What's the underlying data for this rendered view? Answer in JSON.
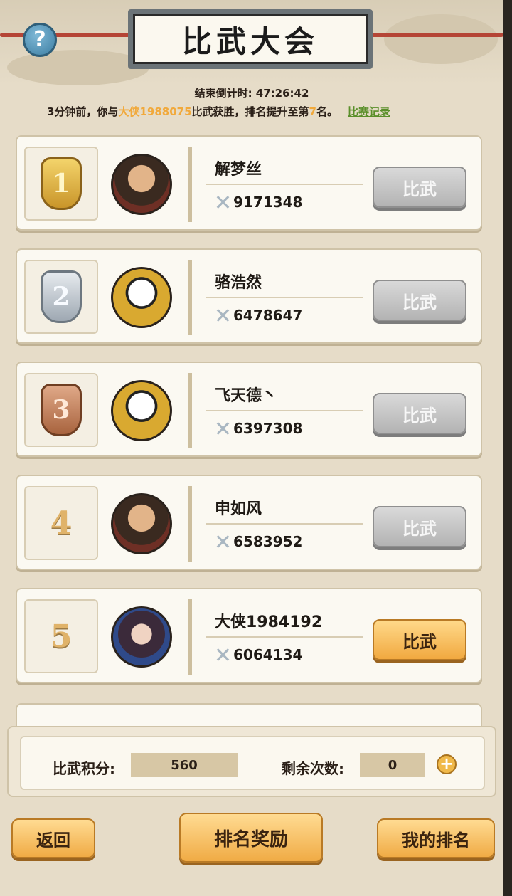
{
  "header": {
    "title": "比武大会",
    "help_icon": "?",
    "countdown_label": "结束倒计时:",
    "countdown_value": "47:26:42"
  },
  "notice": {
    "prefix": "3分钟前，你与",
    "opponent": "大侠1988075",
    "middle": "比武获胜，排名提升至第",
    "rank": "7",
    "suffix": "名。",
    "record_link": "比赛记录"
  },
  "rows": [
    {
      "rank": "1",
      "badge": "gold",
      "name": "解梦丝",
      "power": "9171348",
      "button": "比武",
      "button_style": "gray",
      "avatar": "hero-icon"
    },
    {
      "rank": "2",
      "badge": "silver",
      "name": "骆浩然",
      "power": "6478647",
      "button": "比武",
      "button_style": "gray",
      "avatar": "panda-icon"
    },
    {
      "rank": "3",
      "badge": "bronze",
      "name": "飞天德丶",
      "power": "6397308",
      "button": "比武",
      "button_style": "gray",
      "avatar": "panda-icon"
    },
    {
      "rank": "4",
      "badge": "plain",
      "name": "申如风",
      "power": "6583952",
      "button": "比武",
      "button_style": "gray",
      "avatar": "hero-icon"
    },
    {
      "rank": "5",
      "badge": "plain",
      "name": "大侠1984192",
      "power": "6064134",
      "button": "比武",
      "button_style": "gold",
      "avatar": "lady-icon"
    }
  ],
  "score": {
    "points_label": "比武积分:",
    "points_value": "560",
    "remaining_label": "剩余次数:",
    "remaining_value": "0"
  },
  "buttons": {
    "back": "返回",
    "rank_reward": "排名奖励",
    "my_rank": "我的排名"
  },
  "colors": {
    "accent_gold": "#f0ab45",
    "highlight": "#f1a93b",
    "link_green": "#5a8f2a"
  }
}
